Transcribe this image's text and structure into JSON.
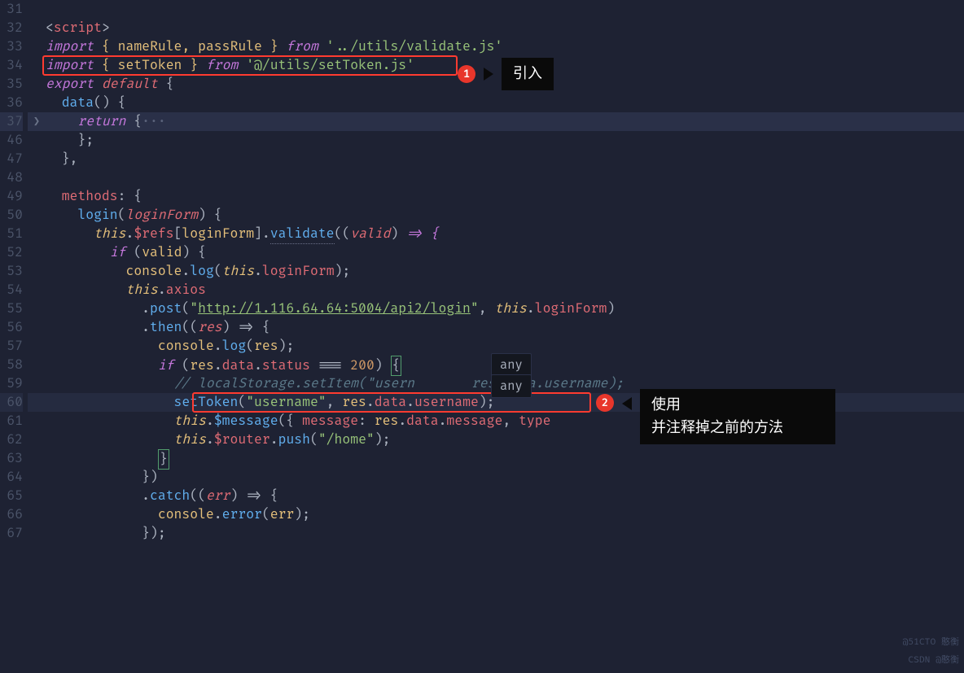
{
  "gutter": [
    "31",
    "32",
    "33",
    "34",
    "35",
    "36",
    "37",
    "46",
    "47",
    "48",
    "49",
    "50",
    "51",
    "52",
    "53",
    "54",
    "55",
    "56",
    "57",
    "58",
    "59",
    "60",
    "61",
    "62",
    "63",
    "64",
    "65",
    "66",
    "67"
  ],
  "fold_marker": "❯",
  "code": {
    "l31": {
      "tag": "script"
    },
    "l32": {
      "kw": "import",
      "names": "{ nameRule, passRule }",
      "from": "from",
      "path": "'../utils/validate.js'"
    },
    "l33": {
      "kw": "import",
      "names": "{ setToken }",
      "from": "from",
      "path": "'@/utils/setToken.js'"
    },
    "l34": {
      "kw": "export",
      "def": "default",
      "brace": " {"
    },
    "l35": {
      "fn": "data",
      "rest": "() {"
    },
    "l36": {
      "kw": "return",
      "rest": " {",
      "fold": "···"
    },
    "l37": {
      "rest": "};"
    },
    "l38": {
      "rest": "},"
    },
    "l39": {
      "rest": ""
    },
    "l40": {
      "prop": "methods",
      "rest": ": {"
    },
    "l41": {
      "fn": "login",
      "param": "loginForm",
      "rest": ") {"
    },
    "l42": {
      "this": "this",
      "refs": "$refs",
      "arg": "loginForm",
      "vfn": "validate",
      "param2": "valid",
      "arrow": " => {"
    },
    "l43": {
      "kw": "if",
      "cond": "valid",
      "rest": ") {"
    },
    "l44": {
      "obj": "console",
      "fn": "log",
      "this": "this",
      "prop": "loginForm",
      "rest": ");"
    },
    "l45": {
      "this": "this",
      "prop": "axios"
    },
    "l46": {
      "fn": "post",
      "url": "http://1.116.64.64:5004/api2/login",
      "this": "this",
      "prop": "loginForm",
      "rest": ")"
    },
    "l47": {
      "fn": "then",
      "param": "res",
      "arrow": ") => {"
    },
    "l48": {
      "obj": "console",
      "fn": "log",
      "arg": "res",
      "rest": ");"
    },
    "l49": {
      "kw": "if",
      "obj": "res",
      "p1": "data",
      "p2": "status",
      "op": "===",
      "num": "200",
      "rest": ") "
    },
    "l50": {
      "cmt": "// localStorage.setItem(\"usern",
      "cmt2": "res.data.username);"
    },
    "l51": {
      "fn": "setToken",
      "arg1": "\"username\"",
      "obj": "res",
      "p1": "data",
      "p2": "username",
      "rest": ");"
    },
    "l52": {
      "this": "this",
      "fn": "$message",
      "k1": "message",
      "obj": "res",
      "p1": "data",
      "p2": "message",
      "k2": "type"
    },
    "l53": {
      "this": "this",
      "fn": "$router",
      "fn2": "push",
      "arg": "\"/home\"",
      "rest": ");"
    },
    "l54": {
      "rest": ""
    },
    "l55": {
      "rest": "})"
    },
    "l56": {
      "fn": "catch",
      "param": "err",
      "arrow": ") => {"
    },
    "l57": {
      "obj": "console",
      "fn": "error",
      "arg": "err",
      "rest": ");"
    },
    "l58": {
      "rest": "});"
    }
  },
  "tooltip": {
    "line1": "any",
    "line2": "any"
  },
  "annotation1": {
    "badge": "1",
    "text": "引入"
  },
  "annotation2": {
    "badge": "2",
    "text1": "使用",
    "text2": "并注释掉之前的方法"
  },
  "watermarks": {
    "top": "@51CTO 憨衡",
    "bottom": "CSDN @憨衡"
  }
}
